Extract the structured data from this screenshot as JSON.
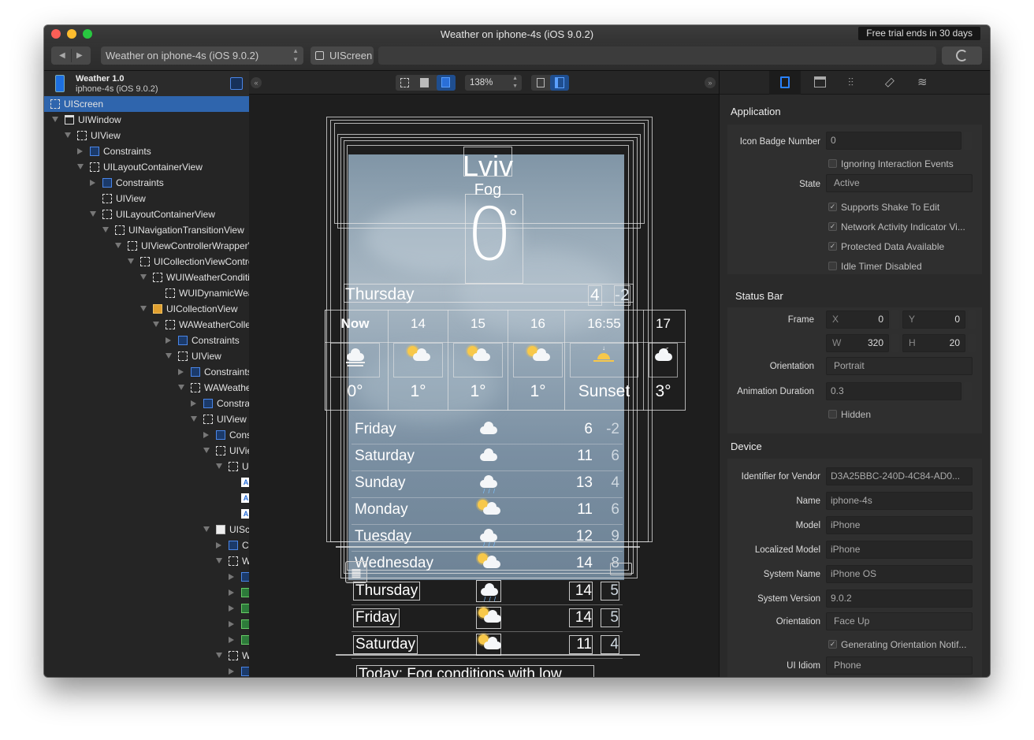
{
  "window": {
    "title": "Weather on iphone-4s (iOS 9.0.2)",
    "trial": "Free trial ends in 30 days"
  },
  "toolbar": {
    "target": "Weather on iphone-4s (iOS 9.0.2)",
    "screen": "UIScreen"
  },
  "app": {
    "name": "Weather 1.0",
    "device": "iphone-4s (iOS 9.0.2)"
  },
  "tree": [
    {
      "label": "UIScreen",
      "indent": 0,
      "icon": "screen",
      "disclosure": "none",
      "selected": true
    },
    {
      "label": "UIWindow",
      "indent": 0,
      "icon": "window",
      "disclosure": "open"
    },
    {
      "label": "UIView",
      "indent": 1,
      "icon": "view",
      "disclosure": "open"
    },
    {
      "label": "Constraints",
      "indent": 2,
      "icon": "constraints",
      "disclosure": "closed"
    },
    {
      "label": "UILayoutContainerView",
      "indent": 2,
      "icon": "view",
      "disclosure": "open"
    },
    {
      "label": "Constraints",
      "indent": 3,
      "icon": "constraints",
      "disclosure": "closed"
    },
    {
      "label": "UIView",
      "indent": 3,
      "icon": "view",
      "disclosure": "none"
    },
    {
      "label": "UILayoutContainerView",
      "indent": 3,
      "icon": "view",
      "disclosure": "open"
    },
    {
      "label": "UINavigationTransitionView",
      "indent": 4,
      "icon": "view",
      "disclosure": "open"
    },
    {
      "label": "UIViewControllerWrapperView",
      "indent": 5,
      "icon": "view",
      "disclosure": "open"
    },
    {
      "label": "UICollectionViewController",
      "indent": 6,
      "icon": "view",
      "disclosure": "open"
    },
    {
      "label": "WUIWeatherConditionView",
      "indent": 7,
      "icon": "view",
      "disclosure": "open"
    },
    {
      "label": "WUIDynamicWeather",
      "indent": 8,
      "icon": "view",
      "disclosure": "none"
    },
    {
      "label": "UICollectionView",
      "indent": 7,
      "icon": "collection",
      "disclosure": "open"
    },
    {
      "label": "WAWeatherCollectionCell",
      "indent": 8,
      "icon": "view",
      "disclosure": "open"
    },
    {
      "label": "Constraints",
      "indent": 9,
      "icon": "constraints",
      "disclosure": "closed"
    },
    {
      "label": "UIView",
      "indent": 9,
      "icon": "view",
      "disclosure": "open"
    },
    {
      "label": "Constraints",
      "indent": 10,
      "icon": "constraints",
      "disclosure": "closed"
    },
    {
      "label": "WAWeatherView",
      "indent": 10,
      "icon": "view",
      "disclosure": "open"
    },
    {
      "label": "Constraints",
      "indent": 11,
      "icon": "constraints",
      "disclosure": "closed"
    },
    {
      "label": "UIView",
      "indent": 11,
      "icon": "view",
      "disclosure": "open"
    },
    {
      "label": "Constraints",
      "indent": 12,
      "icon": "constraints",
      "disclosure": "closed"
    },
    {
      "label": "UIView",
      "indent": 12,
      "icon": "view",
      "disclosure": "open"
    },
    {
      "label": "UIView",
      "indent": 13,
      "icon": "view",
      "disclosure": "open"
    },
    {
      "label": "",
      "indent": 14,
      "icon": "label",
      "disclosure": "none"
    },
    {
      "label": "",
      "indent": 14,
      "icon": "label",
      "disclosure": "none"
    },
    {
      "label": "",
      "indent": 14,
      "icon": "label",
      "disclosure": "none"
    },
    {
      "label": "UIScrollView",
      "indent": 12,
      "icon": "scroll",
      "disclosure": "open"
    },
    {
      "label": "Constraints",
      "indent": 13,
      "icon": "constraints",
      "disclosure": "closed"
    },
    {
      "label": "WAView",
      "indent": 13,
      "icon": "view",
      "disclosure": "open"
    },
    {
      "label": "",
      "indent": 14,
      "icon": "constraints",
      "disclosure": "closed"
    },
    {
      "label": "",
      "indent": 14,
      "icon": "image",
      "disclosure": "closed"
    },
    {
      "label": "",
      "indent": 14,
      "icon": "image",
      "disclosure": "closed"
    },
    {
      "label": "",
      "indent": 14,
      "icon": "image",
      "disclosure": "closed"
    },
    {
      "label": "",
      "indent": 14,
      "icon": "image",
      "disclosure": "closed"
    },
    {
      "label": "WAView",
      "indent": 13,
      "icon": "view",
      "disclosure": "open"
    },
    {
      "label": "",
      "indent": 14,
      "icon": "constraints",
      "disclosure": "closed"
    }
  ],
  "canvas": {
    "zoom": "138%"
  },
  "weather": {
    "city": "Lviv",
    "condition": "Fog",
    "temp": "0",
    "degree": "°",
    "today": {
      "day": "Thursday",
      "high": "4",
      "low": "-2"
    },
    "hourly": [
      {
        "time": "Now",
        "temp": "0°",
        "icon": "fog-icon"
      },
      {
        "time": "14",
        "temp": "1°",
        "icon": "partly-sunny-icon"
      },
      {
        "time": "15",
        "temp": "1°",
        "icon": "partly-sunny-icon"
      },
      {
        "time": "16",
        "temp": "1°",
        "icon": "partly-sunny-icon"
      },
      {
        "time": "16:55",
        "temp": "Sunset",
        "icon": "sunset-icon"
      },
      {
        "time": "17",
        "temp": "3°",
        "icon": "partly-cloudy-night-icon"
      }
    ],
    "daily": [
      {
        "day": "Friday",
        "icon": "cloud-icon",
        "high": "6",
        "low": "-2"
      },
      {
        "day": "Saturday",
        "icon": "cloud-icon",
        "high": "11",
        "low": "6"
      },
      {
        "day": "Sunday",
        "icon": "rain-icon",
        "high": "13",
        "low": "4"
      },
      {
        "day": "Monday",
        "icon": "partly-sunny-icon",
        "high": "11",
        "low": "6"
      },
      {
        "day": "Tuesday",
        "icon": "rain-icon",
        "high": "12",
        "low": "9"
      },
      {
        "day": "Wednesday",
        "icon": "partly-sunny-icon",
        "high": "14",
        "low": "8"
      },
      {
        "day": "Thursday",
        "icon": "rain-icon",
        "high": "14",
        "low": "5"
      },
      {
        "day": "Friday",
        "icon": "partly-sunny-icon",
        "high": "14",
        "low": "5"
      },
      {
        "day": "Saturday",
        "icon": "partly-sunny-icon",
        "high": "11",
        "low": "4"
      }
    ],
    "summary": "Today: Fog conditions with low"
  },
  "inspector": {
    "application": {
      "title": "Application",
      "icon_badge_label": "Icon Badge Number",
      "icon_badge_value": "0",
      "ignoring": "Ignoring Interaction Events",
      "state_label": "State",
      "state_value": "Active",
      "shake": "Supports Shake To Edit",
      "network": "Network Activity Indicator Vi...",
      "protected": "Protected Data Available",
      "idle": "Idle Timer Disabled"
    },
    "status_bar": {
      "title": "Status Bar",
      "frame_label": "Frame",
      "x_label": "X",
      "x_value": "0",
      "y_label": "Y",
      "y_value": "0",
      "w_label": "W",
      "w_value": "320",
      "h_label": "H",
      "h_value": "20",
      "orientation_label": "Orientation",
      "orientation_value": "Portrait",
      "animation_label": "Animation Duration",
      "animation_value": "0.3",
      "hidden": "Hidden"
    },
    "device": {
      "title": "Device",
      "vendor_label": "Identifier for Vendor",
      "vendor_value": "D3A25BBC-240D-4C84-AD0...",
      "name_label": "Name",
      "name_value": "iphone-4s",
      "model_label": "Model",
      "model_value": "iPhone",
      "lmodel_label": "Localized Model",
      "lmodel_value": "iPhone",
      "sysname_label": "System Name",
      "sysname_value": "iPhone OS",
      "sysver_label": "System Version",
      "sysver_value": "9.0.2",
      "orient_label": "Orientation",
      "orient_value": "Face Up",
      "gen_orient": "Generating Orientation Notif...",
      "idiom_label": "UI Idiom",
      "idiom_value": "Phone"
    }
  },
  "colors": {
    "selection": "#2f65ad",
    "accent": "#2a82ff",
    "close": "#fc5f57",
    "minimize": "#fdbc2e",
    "zoom": "#28c840"
  }
}
